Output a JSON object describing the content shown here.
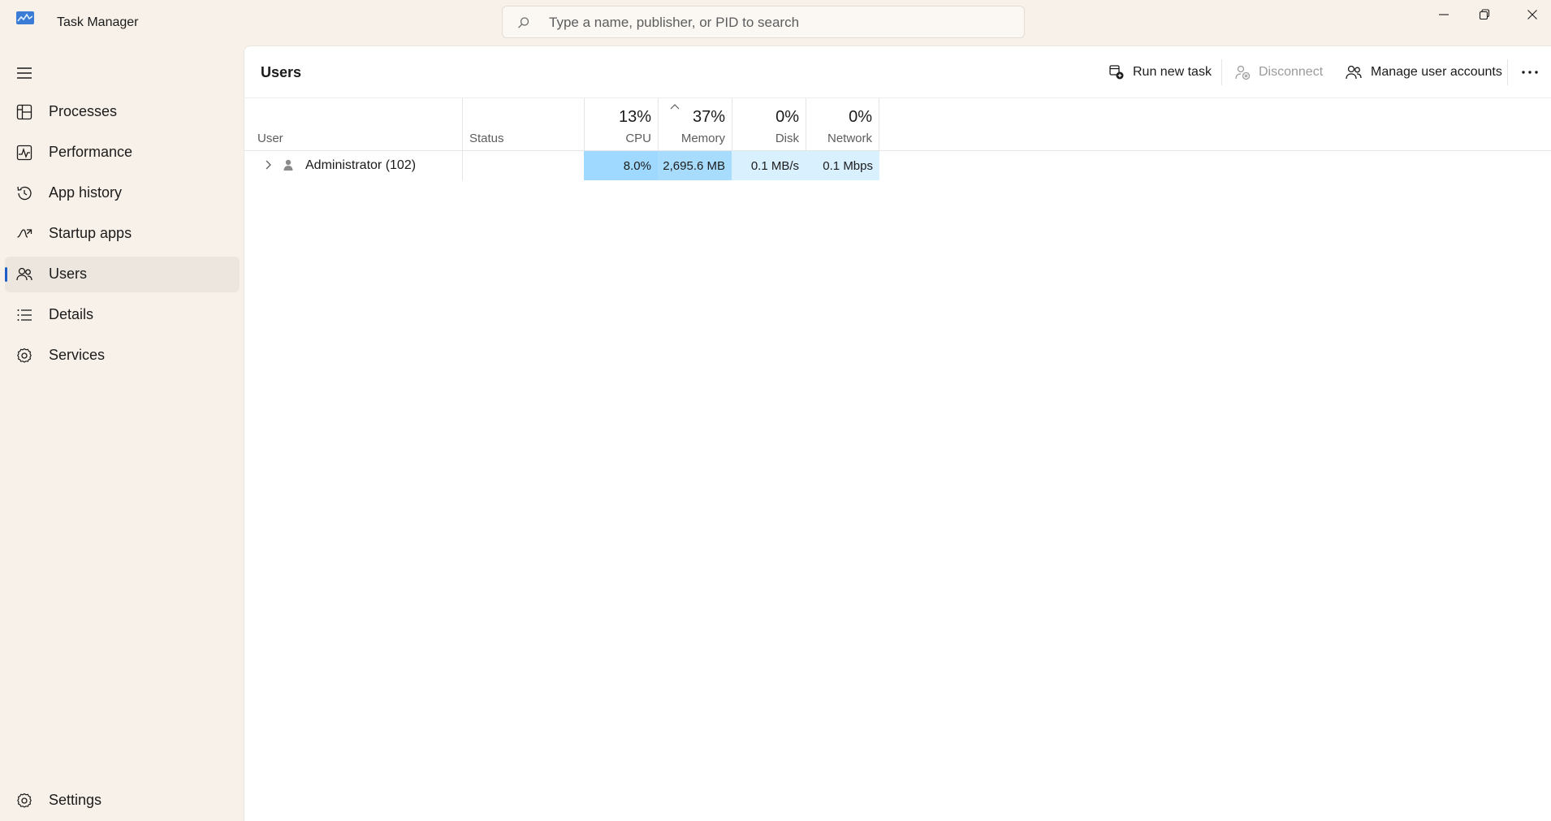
{
  "window": {
    "title": "Task Manager",
    "controls": [
      "minimize",
      "restore",
      "close"
    ]
  },
  "search": {
    "placeholder": "Type a name, publisher, or PID to search"
  },
  "sidebar": {
    "items": [
      {
        "label": "Processes",
        "icon": "processes-icon"
      },
      {
        "label": "Performance",
        "icon": "performance-icon"
      },
      {
        "label": "App history",
        "icon": "app-history-icon"
      },
      {
        "label": "Startup apps",
        "icon": "startup-apps-icon"
      },
      {
        "label": "Users",
        "icon": "users-icon",
        "active": true
      },
      {
        "label": "Details",
        "icon": "details-icon"
      },
      {
        "label": "Services",
        "icon": "services-icon"
      }
    ],
    "settings_label": "Settings"
  },
  "page": {
    "title": "Users"
  },
  "toolbar": {
    "run_new_task": "Run new task",
    "disconnect": "Disconnect",
    "manage_user_accounts": "Manage user accounts",
    "more": "..."
  },
  "table": {
    "columns": {
      "user": "User",
      "status": "Status",
      "cpu": {
        "label": "CPU",
        "total": "13%"
      },
      "memory": {
        "label": "Memory",
        "total": "37%"
      },
      "disk": {
        "label": "Disk",
        "total": "0%"
      },
      "network": {
        "label": "Network",
        "total": "0%"
      }
    },
    "rows": [
      {
        "user": "Administrator (102)",
        "status": "",
        "cpu": "8.0%",
        "memory": "2,695.6 MB",
        "disk": "0.1 MB/s",
        "network": "0.1 Mbps"
      }
    ]
  },
  "colors": {
    "accent": "#1e5fc7",
    "heat_high": "#9fd9ff",
    "heat_med": "#a8dcfc",
    "heat_low": "#d9f0ff"
  }
}
